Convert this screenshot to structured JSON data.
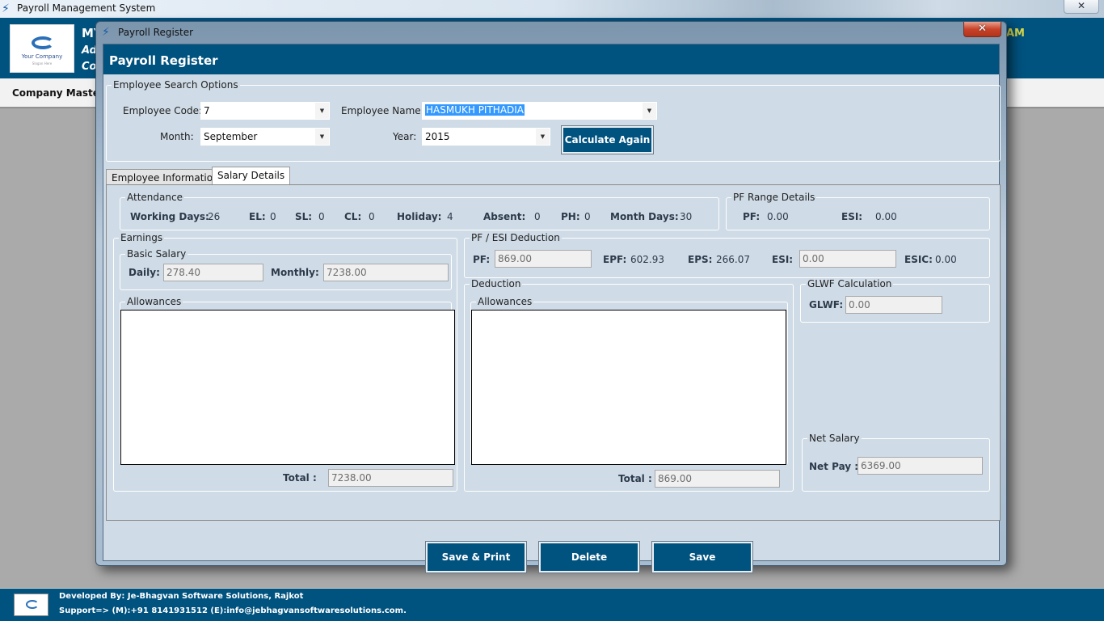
{
  "main_window": {
    "title": "Payroll Management System",
    "close_glyph": "✕",
    "header": {
      "company_logo_text": "Your Company",
      "company_logo_slogan": "Slogan Here",
      "line1_partial": "MY",
      "line2_partial": "Ad",
      "line3_partial": "Co",
      "time_partial": "AM"
    },
    "menu": {
      "items": [
        {
          "label": "Company Master"
        }
      ]
    },
    "footer": {
      "developed_by": "Developed By: Je-Bhagvan Software Solutions, Rajkot",
      "support": "Support=> (M):+91 8141931512 (E):info@jebhagvansoftwaresolutions.com."
    }
  },
  "dialog": {
    "window_title": "Payroll Register",
    "close_glyph": "✕",
    "header_title": "Payroll Register",
    "search_options": {
      "group_label": "Employee Search Options",
      "employee_code_label": "Employee Code:",
      "employee_code_value": "7",
      "employee_name_label": "Employee Name:",
      "employee_name_value": "HASMUKH PITHADIA",
      "month_label": "Month:",
      "month_value": "September",
      "year_label": "Year:",
      "year_value": "2015",
      "calculate_button": "Calculate Again",
      "dropdown_glyph": "▼"
    },
    "tabs": [
      {
        "label": "Employee Information",
        "active": false
      },
      {
        "label": "Salary Details",
        "active": true
      }
    ],
    "salary_details": {
      "attendance": {
        "group_label": "Attendance",
        "items": [
          {
            "label": "Working Days:",
            "value": "26"
          },
          {
            "label": "EL:",
            "value": "0"
          },
          {
            "label": "SL:",
            "value": "0"
          },
          {
            "label": "CL:",
            "value": "0"
          },
          {
            "label": "Holiday:",
            "value": "4"
          },
          {
            "label": "Absent:",
            "value": "0"
          },
          {
            "label": "PH:",
            "value": "0"
          },
          {
            "label": "Month Days:",
            "value": "30"
          }
        ]
      },
      "pf_range": {
        "group_label": "PF Range Details",
        "pf_label": "PF:",
        "pf_value": "0.00",
        "esi_label": "ESI:",
        "esi_value": "0.00"
      },
      "earnings": {
        "group_label": "Earnings",
        "basic_salary_label": "Basic Salary",
        "daily_label": "Daily:",
        "daily_value": "278.40",
        "monthly_label": "Monthly:",
        "monthly_value": "7238.00",
        "allowances_label": "Allowances",
        "total_label": "Total :",
        "total_value": "7238.00"
      },
      "pf_esi_deduction": {
        "group_label": "PF / ESI Deduction",
        "pf_label": "PF:",
        "pf_value": "869.00",
        "epf_label": "EPF:",
        "epf_value": "602.93",
        "eps_label": "EPS:",
        "eps_value": "266.07",
        "esi_label": "ESI:",
        "esi_value": "0.00",
        "esic_label": "ESIC:",
        "esic_value": "0.00"
      },
      "deduction": {
        "group_label": "Deduction",
        "allowances_label": "Allowances",
        "total_label": "Total :",
        "total_value": "869.00"
      },
      "glwf": {
        "group_label": "GLWF Calculation",
        "glwf_label": "GLWF:",
        "glwf_value": "0.00"
      },
      "net_salary": {
        "group_label": "Net Salary",
        "net_pay_label": "Net Pay :",
        "net_pay_value": "6369.00"
      }
    },
    "actions": {
      "save_print": "Save & Print",
      "delete": "Delete",
      "save": "Save"
    }
  },
  "colors": {
    "brand_blue": "#00527f",
    "panel_bg": "#cfdbe6",
    "selection": "#3399ff",
    "close_red": "#c8432a"
  }
}
